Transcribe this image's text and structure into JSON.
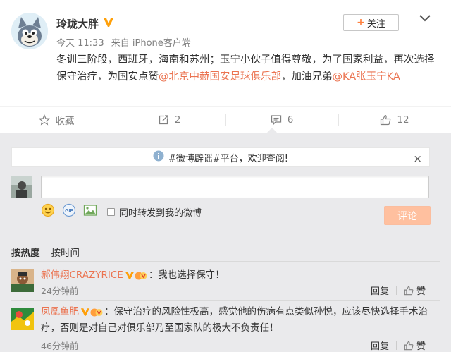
{
  "post": {
    "author": "玲珑大胖",
    "time": "今天 11:33",
    "source": "来自 iPhone客户端",
    "text_1": "冬训三阶段，西班牙，海南和苏州；玉宁小伙子值得尊敬，为了国家利益，再次选择保守治疗，为国安点赞",
    "mention_1": "@北京中赫国安足球俱乐部",
    "text_2": "，加油兄弟",
    "mention_2": "@KA张玉宁KA",
    "follow_label": "关注",
    "follow_plus": "+"
  },
  "actions": {
    "favorite_label": "收藏",
    "repost_count": "2",
    "comment_count": "6",
    "like_count": "12"
  },
  "comment_box": {
    "notice_text": "#微博辟谣#平台，欢迎查阅!",
    "notice_close": "×",
    "input_value": "",
    "repost_label": "同时转发到我的微博",
    "submit_label": "评论"
  },
  "sort": {
    "hot": "按热度",
    "time": "按时间"
  },
  "comments": [
    {
      "user": "郝伟翔CRAZYRICE",
      "text": "：我也选择保守！",
      "time": "24分钟前",
      "reply_label": "回复",
      "like_label": "赞"
    },
    {
      "user": "凤凰鱼肥",
      "text": "：保守治疗的风险性极高，感觉他的伤病有点类似孙悦，应该尽快选择手术治疗，否则是对自己对俱乐部乃至国家队的极大不负责任！",
      "time": "46分钟前",
      "reply_label": "回复",
      "like_label": "赞"
    }
  ],
  "colors": {
    "link": "#eb7350",
    "verified": "#ffa00a",
    "comment_bg": "#eaeaec",
    "submit_disabled": "#ffc09f"
  }
}
